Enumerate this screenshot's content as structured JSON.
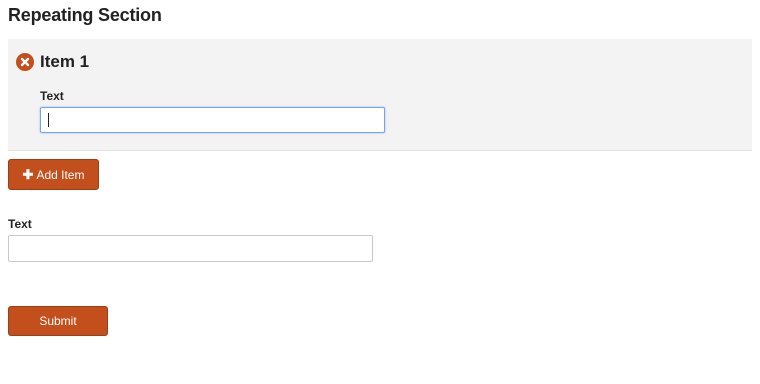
{
  "section": {
    "title": "Repeating Section",
    "items": [
      {
        "title": "Item 1",
        "remove_icon": "close-circle-icon",
        "field_label": "Text",
        "field_value": ""
      }
    ],
    "add_button": {
      "icon": "plus-icon",
      "label": "Add Item"
    }
  },
  "form": {
    "text_label": "Text",
    "text_value": "",
    "submit_label": "Submit"
  },
  "colors": {
    "accent": "#c24f1c",
    "panel_background": "#f3f3f3",
    "focus_border": "#7aa3e0"
  }
}
